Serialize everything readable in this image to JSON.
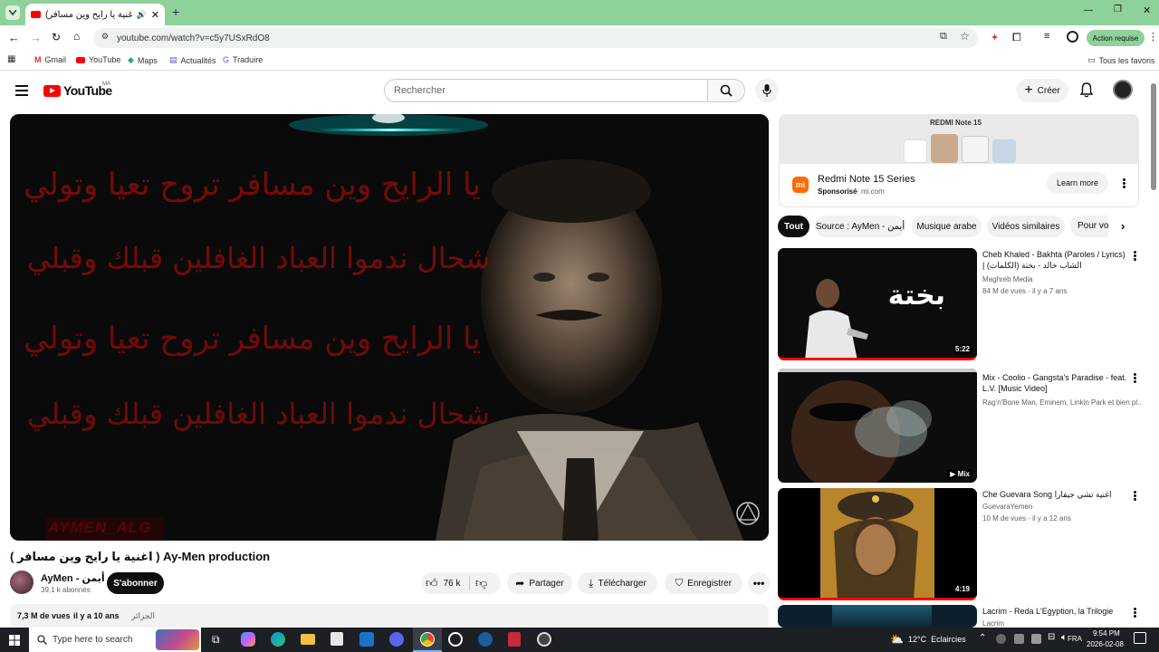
{
  "browser": {
    "tab_title": "(اغنية يا رايح وين مسافر) Ay",
    "url": "youtube.com/watch?v=c5y7USxRdO8",
    "action_required": "Action requise",
    "bookmarks": [
      "Gmail",
      "YouTube",
      "Maps",
      "Actualités",
      "Traduire"
    ],
    "all_bookmarks": "Tous les favoris"
  },
  "header": {
    "logo": "YouTube",
    "region": "MA",
    "search_placeholder": "Rechercher",
    "create_label": "Créer"
  },
  "video": {
    "overlay_lines": [
      "يا الرايح وين مسافر تروح تعيا وتولي",
      "شحال ندموا العباد الغافلين قبلك وقبلي",
      "يا الرايح وين مسافر تروح تعيا وتولي",
      "شحال ندموا العباد الغافلين قبلك وقبلي"
    ],
    "watermark": "AYMEN_ALG",
    "title": "( اغنية يا رايح وين مسافر ) Ay-Men production",
    "channel": "AyMen - أيمن",
    "subscribers": "39,1 k abonnés",
    "subscribe_label": "S'abonner",
    "likes": "76 k",
    "share_label": "Partager",
    "download_label": "Télécharger",
    "save_label": "Enregistrer",
    "views": "7,3 M de vues",
    "age": "il y a 10 ans",
    "location": "الجزائر"
  },
  "ad": {
    "banner_text": "REDMI Note 15",
    "title": "Redmi Note 15 Series",
    "sponsored": "Sponsorisé",
    "domain": "mi.com",
    "cta": "Learn more"
  },
  "chips": [
    "Tout",
    "Source : AyMen - أيمن",
    "Musique arabe",
    "Vidéos similaires",
    "Pour vous"
  ],
  "related": [
    {
      "title": "Cheb Khaled - Bakhta (Paroles / Lyrics) | (الشاب خالد - بختة (الكلمات",
      "channel": "Maghreb Media",
      "meta": "84 M de vues · il y a 7 ans",
      "duration": "5:22",
      "thumb_text": "بختة"
    },
    {
      "title": "Mix - Coolio - Gangsta's Paradise - feat. L.V. [Music Video]",
      "channel": "Rag'n'Bone Man, Eminem, Linkin Park et bien pl...",
      "meta": "",
      "duration": "Mix"
    },
    {
      "title": "Che Guevara Song اغنية تشي جيفارا",
      "channel": "GuevaraYemen",
      "meta": "10 M de vues · il y a 12 ans",
      "duration": "4:19"
    },
    {
      "title": "Lacrim - Reda L'Egyption, la Trilogie",
      "channel": "Lacrim",
      "meta": "",
      "duration": ""
    }
  ],
  "taskbar": {
    "search_placeholder": "Type here to search",
    "weather": "12°C  Eclaircies",
    "lang": "FRA",
    "time": "9:54 PM",
    "date": "2026-02-08"
  }
}
